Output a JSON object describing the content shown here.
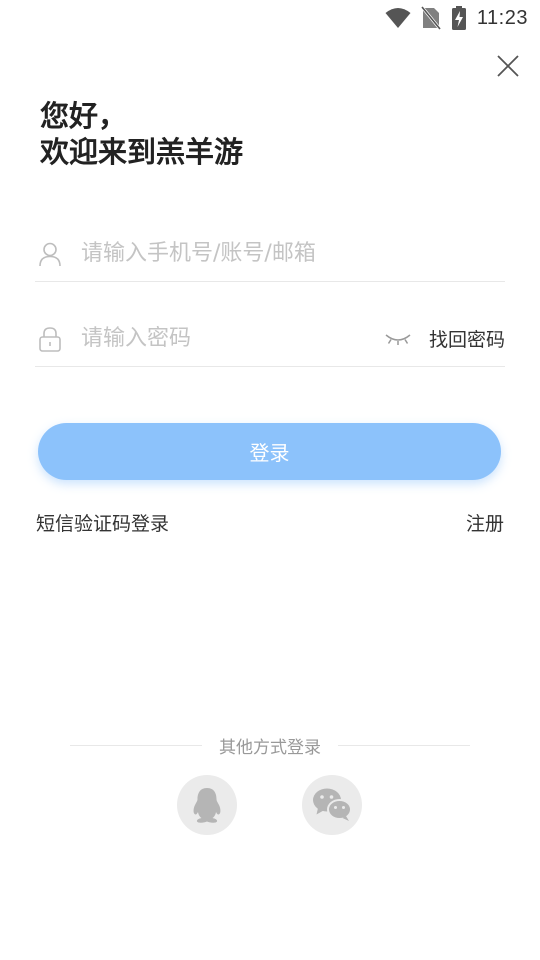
{
  "status_bar": {
    "time": "11:23",
    "icons": [
      "wifi-icon",
      "no-sim-icon",
      "battery-charging-icon"
    ]
  },
  "header": {
    "close_icon": "close-icon"
  },
  "greeting": {
    "line1": "您好，",
    "line2": "欢迎来到羔羊游"
  },
  "form": {
    "account": {
      "icon": "user-icon",
      "value": "",
      "placeholder": "请输入手机号/账号/邮箱"
    },
    "password": {
      "icon": "lock-icon",
      "value": "",
      "placeholder": "请输入密码",
      "toggle_icon": "eye-closed-icon",
      "forgot_label": "找回密码"
    },
    "login_label": "登录"
  },
  "links": {
    "sms_login": "短信验证码登录",
    "register": "注册"
  },
  "other_login": {
    "label": "其他方式登录",
    "providers": [
      "qq-icon",
      "wechat-icon"
    ]
  },
  "colors": {
    "accent": "#8cc2fb",
    "placeholder": "#c4c4c4",
    "divider": "#e8e8e8",
    "social_bg": "#ebebeb"
  }
}
